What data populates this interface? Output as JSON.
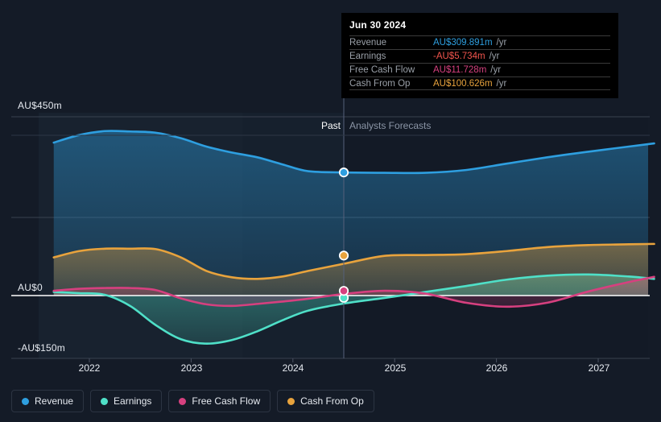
{
  "chart_data": {
    "type": "area",
    "title": "",
    "xlabel": "",
    "ylabel": "",
    "currency": "AU$",
    "unit": "m",
    "ylim": [
      -150,
      450
    ],
    "grid": true,
    "legend_position": "bottom-left",
    "x_tick_labels": [
      "2022",
      "2023",
      "2024",
      "2025",
      "2026",
      "2027"
    ],
    "y_tick_labels": [
      "AU$450m",
      "AU$0",
      "-AU$150m"
    ],
    "y_tick_values": [
      450,
      0,
      -150
    ],
    "zero_line": 0,
    "past_forecast_split": "Jun 30 2024",
    "bands": [
      {
        "label": "Past",
        "align": "right"
      },
      {
        "label": "Analysts Forecasts",
        "align": "left"
      }
    ],
    "series": [
      {
        "name": "Revenue",
        "color": "#2e9fe0",
        "marker_value": 309.891,
        "x": [
          2021.65,
          2021.9,
          2022.15,
          2022.4,
          2022.65,
          2022.9,
          2023.15,
          2023.4,
          2023.65,
          2023.9,
          2024.15,
          2024.5,
          2024.9,
          2025.3,
          2025.7,
          2026.1,
          2026.5,
          2026.9,
          2027.3,
          2027.55
        ],
        "values": [
          385,
          404,
          414,
          413,
          410,
          396,
          375,
          360,
          348,
          330,
          313,
          310,
          309,
          309,
          316,
          332,
          348,
          362,
          375,
          383
        ]
      },
      {
        "name": "Earnings",
        "color": "#4fe0c8",
        "marker_value": -5.734,
        "x": [
          2021.65,
          2021.9,
          2022.15,
          2022.4,
          2022.65,
          2022.9,
          2023.15,
          2023.4,
          2023.65,
          2023.9,
          2024.15,
          2024.5,
          2024.9,
          2025.3,
          2025.7,
          2026.1,
          2026.5,
          2026.9,
          2027.3,
          2027.55
        ],
        "values": [
          9,
          6,
          2,
          -26,
          -74,
          -110,
          -121,
          -112,
          -90,
          -62,
          -38,
          -20,
          -6,
          9,
          24,
          40,
          50,
          53,
          48,
          42
        ]
      },
      {
        "name": "Free Cash Flow",
        "color": "#d6407f",
        "marker_value": 11.728,
        "x": [
          2021.65,
          2021.9,
          2022.15,
          2022.4,
          2022.65,
          2022.9,
          2023.15,
          2023.4,
          2023.65,
          2023.9,
          2024.15,
          2024.5,
          2024.9,
          2025.3,
          2025.7,
          2026.1,
          2026.5,
          2026.9,
          2027.3,
          2027.55
        ],
        "values": [
          12,
          17,
          19,
          19,
          14,
          -7,
          -22,
          -26,
          -21,
          -15,
          -8,
          4,
          12,
          5,
          -18,
          -28,
          -18,
          10,
          34,
          47
        ]
      },
      {
        "name": "Cash From Op",
        "color": "#e8a33d",
        "marker_value": 100.626,
        "x": [
          2021.65,
          2021.9,
          2022.15,
          2022.4,
          2022.65,
          2022.9,
          2023.15,
          2023.4,
          2023.65,
          2023.9,
          2024.15,
          2024.5,
          2024.9,
          2025.3,
          2025.7,
          2026.1,
          2026.5,
          2026.9,
          2027.3,
          2027.55
        ],
        "values": [
          96,
          112,
          118,
          118,
          117,
          96,
          62,
          46,
          42,
          48,
          62,
          80,
          100,
          102,
          104,
          112,
          122,
          127,
          129,
          130
        ]
      }
    ]
  },
  "tooltip": {
    "date": "Jun 30 2024",
    "unit_suffix": "/yr",
    "rows": [
      {
        "label": "Revenue",
        "value": "AU$309.891m",
        "color": "#2e9fe0"
      },
      {
        "label": "Earnings",
        "value": "-AU$5.734m",
        "color": "#f2554d"
      },
      {
        "label": "Free Cash Flow",
        "value": "AU$11.728m",
        "color": "#d6407f"
      },
      {
        "label": "Cash From Op",
        "value": "AU$100.626m",
        "color": "#e8a33d"
      }
    ]
  },
  "legend": {
    "items": [
      {
        "label": "Revenue",
        "color": "#2e9fe0"
      },
      {
        "label": "Earnings",
        "color": "#4fe0c8"
      },
      {
        "label": "Free Cash Flow",
        "color": "#d6407f"
      },
      {
        "label": "Cash From Op",
        "color": "#e8a33d"
      }
    ]
  },
  "axis": {
    "y_top": "AU$450m",
    "y_zero": "AU$0",
    "y_bottom": "-AU$150m",
    "x": [
      "2022",
      "2023",
      "2024",
      "2025",
      "2026",
      "2027"
    ]
  },
  "bands": {
    "past": "Past",
    "forecast": "Analysts Forecasts"
  }
}
